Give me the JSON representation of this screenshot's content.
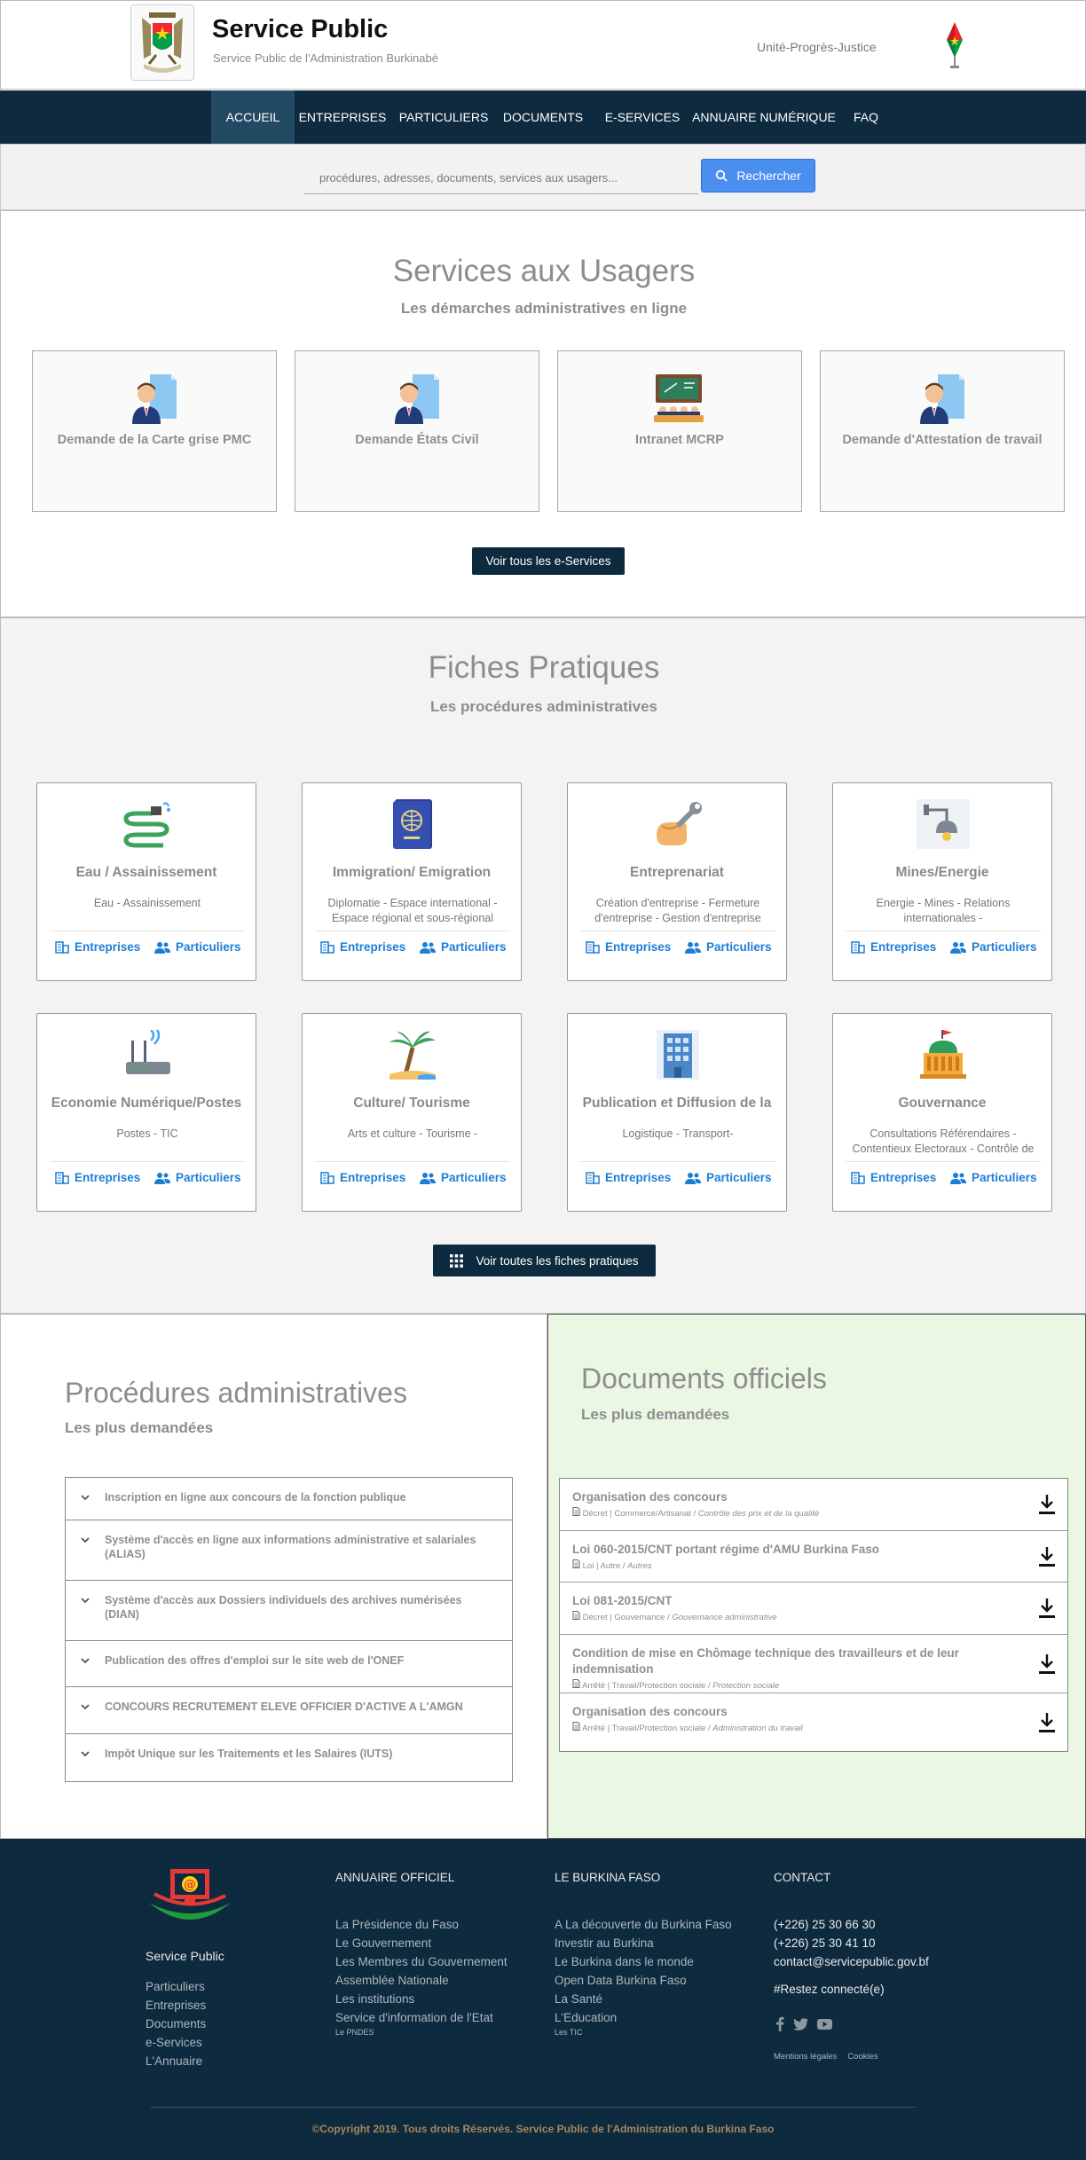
{
  "header": {
    "title": "Service Public",
    "subtitle": "Service Public de l'Administration Burkinabé",
    "motto": "Unité-Progrès-Justice",
    "flag_colors": [
      "#ef2b2d",
      "#009e49",
      "#fcd116"
    ]
  },
  "nav": {
    "items": [
      {
        "label": "ACCUEIL",
        "active": true
      },
      {
        "label": "ENTREPRISES"
      },
      {
        "label": "PARTICULIERS"
      },
      {
        "label": "DOCUMENTS"
      },
      {
        "label": "E-SERVICES"
      },
      {
        "label": "ANNUAIRE NUMÉRIQUE"
      },
      {
        "label": "FAQ"
      }
    ]
  },
  "search": {
    "placeholder": "procédures, adresses, documents, services aux usagers...",
    "button_label": "Rechercher",
    "icon": "search-icon"
  },
  "services": {
    "title": "Services aux Usagers",
    "subtitle": "Les démarches administratives en ligne",
    "cards": [
      {
        "label": "Demande de la Carte grise PMC",
        "icon": "person-document-icon"
      },
      {
        "label": "Demande États Civil",
        "icon": "person-document-icon"
      },
      {
        "label": "Intranet MCRP",
        "icon": "classroom-icon"
      },
      {
        "label": "Demande d'Attestation de travail",
        "icon": "person-document-icon"
      }
    ],
    "button_label": "Voir tous les e-Services"
  },
  "fiches": {
    "title": "Fiches Pratiques",
    "subtitle": "Les procédures administratives",
    "cards": [
      {
        "title": "Eau / Assainissement",
        "desc": "Eau - Assainissement",
        "icon": "water-hose-icon"
      },
      {
        "title": "Immigration/ Emigration",
        "desc": "Diplomatie - Espace international - Espace régional et sous-régional",
        "icon": "passport-icon"
      },
      {
        "title": "Entreprenariat",
        "desc": "Création d'entreprise - Fermeture d'entreprise - Gestion d'entreprise",
        "icon": "handshake-wrench-icon"
      },
      {
        "title": "Mines/Energie",
        "desc": "Energie - Mines - Relations internationales -",
        "icon": "lamp-icon"
      },
      {
        "title": "Economie Numérique/Postes",
        "desc": "Postes - TIC",
        "icon": "router-icon"
      },
      {
        "title": "Culture/ Tourisme",
        "desc": "Arts et culture - Tourisme -",
        "icon": "palm-tree-icon"
      },
      {
        "title": "Publication et Diffusion de la",
        "desc": "Logistique - Transport-",
        "icon": "building-icon"
      },
      {
        "title": "Gouvernance",
        "desc": "Consultations Référendaires - Contentieux Electoraux - Contrôle de",
        "icon": "parliament-icon"
      }
    ],
    "link_entreprises": "Entreprises",
    "link_particuliers": "Particuliers",
    "button_label": "Voir toutes les fiches pratiques"
  },
  "procedures": {
    "title": "Procédures administratives",
    "subtitle": "Les plus demandées",
    "items": [
      "Inscription en ligne aux concours de la fonction publique",
      "Système d'accès en ligne aux informations administrative et salariales (ALIAS)",
      "Système d'accès aux Dossiers individuels des archives numérisées (DIAN)",
      "Publication des offres d'emploi sur le site web de l'ONEF",
      "CONCOURS RECRUTEMENT ELEVE OFFICIER D'ACTIVE A L'AMGN",
      "Impôt Unique sur les Traitements et les Salaires (IUTS)"
    ]
  },
  "documents": {
    "title": "Documents officiels",
    "subtitle": "Les plus demandées",
    "items": [
      {
        "title": "Organisation des concours",
        "meta": "Décret | Commerce/Artisanat",
        "tag": "Contrôle des prix et de la qualité"
      },
      {
        "title": "Loi 060-2015/CNT portant régime d'AMU Burkina Faso",
        "meta": "Loi | Autre",
        "tag": "Autres"
      },
      {
        "title": "Loi 081-2015/CNT",
        "meta": "Décret | Gouvernance",
        "tag": "Gouvernance administrative"
      },
      {
        "title": "Condition de mise en Chômage technique des travailleurs et de leur indemnisation",
        "meta": "Arrêté | Travail/Protection sociale",
        "tag": "Protection sociale"
      },
      {
        "title": "Organisation des concours",
        "meta": "Arrêté | Travail/Protection sociale",
        "tag": "Administration du travail"
      }
    ]
  },
  "footer": {
    "brand": "Service Public",
    "brand_links": [
      "Particuliers",
      "Entreprises",
      "Documents",
      "e-Services",
      "L'Annuaire"
    ],
    "col1": {
      "heading": "ANNUAIRE OFFICIEL",
      "links": [
        "La Présidence du Faso",
        "Le Gouvernement",
        "Les Membres du Gouvernement",
        "Assemblée Nationale",
        "Les institutions",
        "Service d'information de l'Etat"
      ],
      "small": "Le PNDES"
    },
    "col2": {
      "heading": "LE BURKINA FASO",
      "links": [
        "A La découverte du Burkina Faso",
        "Investir au Burkina",
        "Le Burkina dans le monde",
        "Open Data Burkina Faso",
        "La Santé",
        "L'Education"
      ],
      "small": "Les TIC"
    },
    "col3": {
      "heading": "CONTACT",
      "phone1": "(+226) 25 30 66 30",
      "phone2": "(+226) 25 30 41 10",
      "email": "contact@servicepublic.gov.bf",
      "stay_connected": "#Restez connecté(e)",
      "legal": "Mentions légales",
      "cookies": "Cookies"
    },
    "copyright": "©Copyright 2019. Tous droits Réservés. Service Public de l'Administration du Burkina Faso"
  }
}
